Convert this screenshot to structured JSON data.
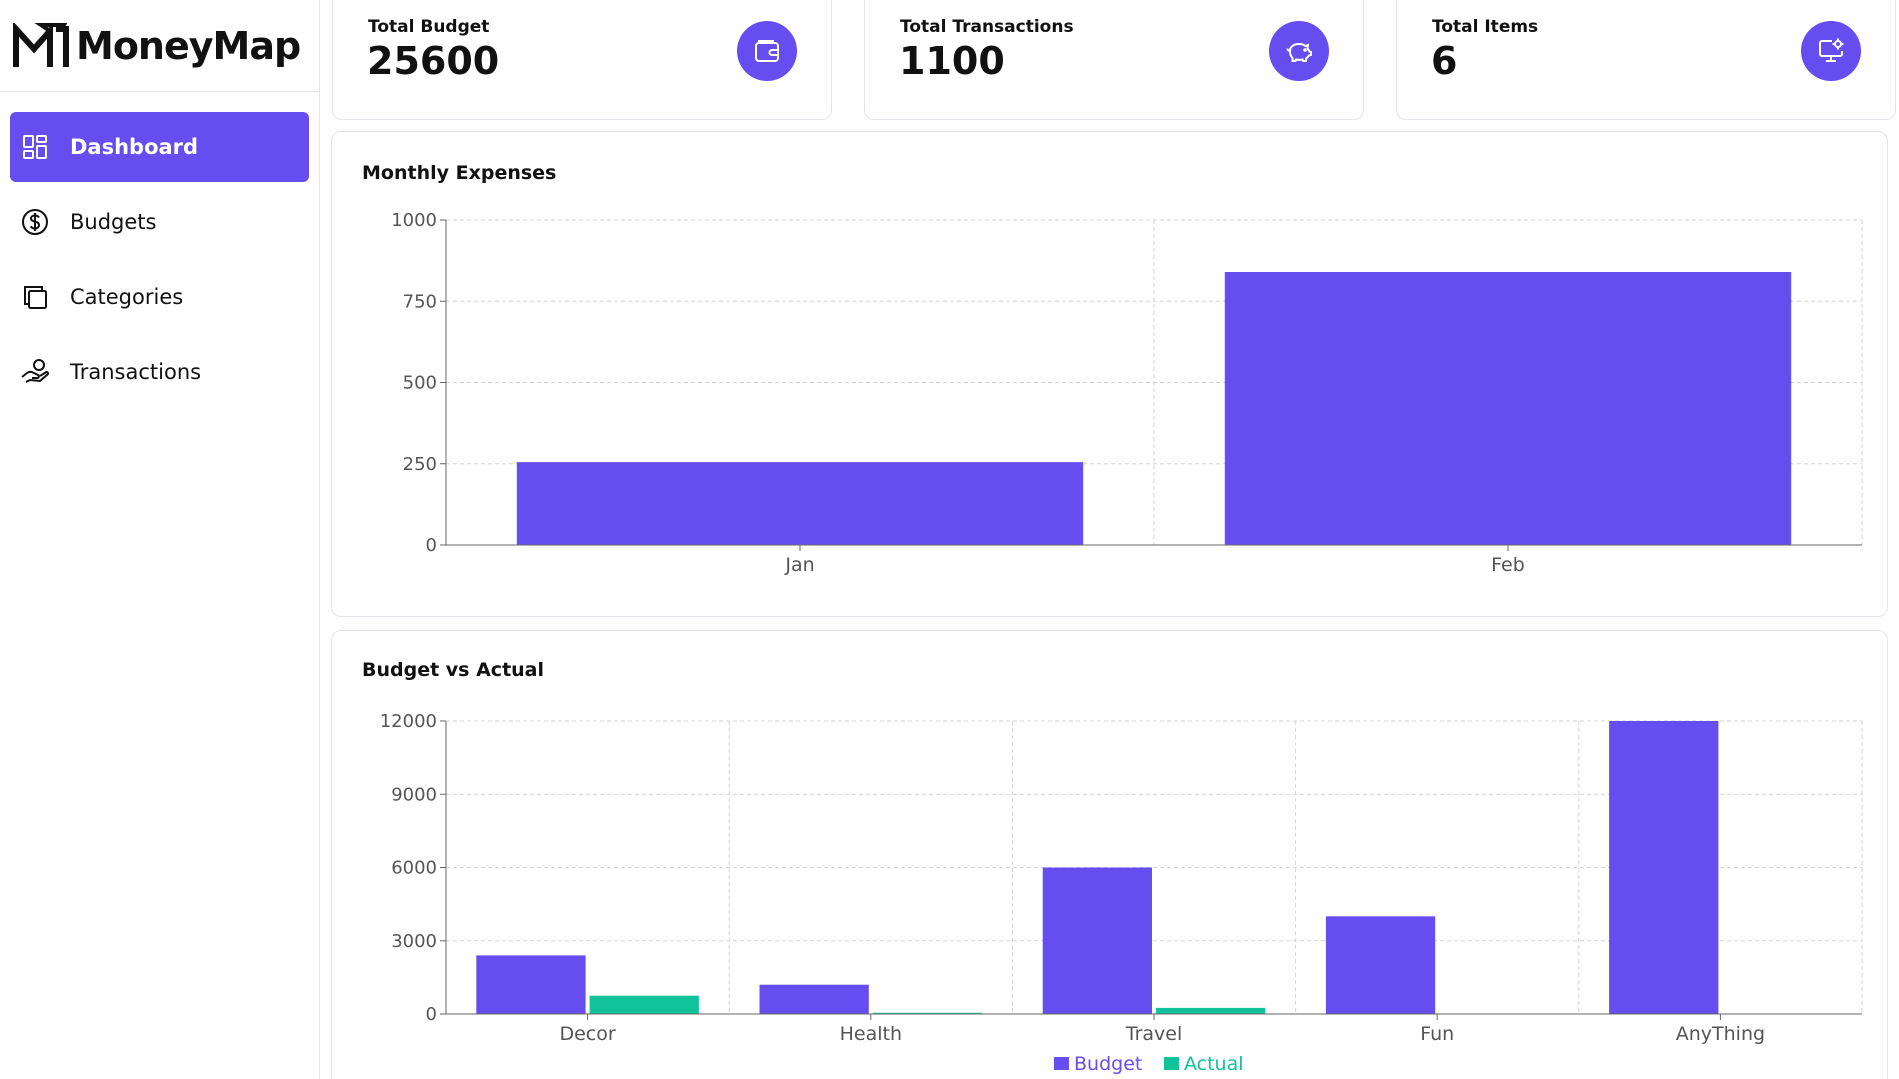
{
  "brand": {
    "name": "MoneyMap"
  },
  "sidebar": {
    "items": [
      {
        "label": "Dashboard",
        "icon": "dashboard-grid-icon",
        "active": true
      },
      {
        "label": "Budgets",
        "icon": "dollar-circle-icon",
        "active": false
      },
      {
        "label": "Categories",
        "icon": "copy-stack-icon",
        "active": false
      },
      {
        "label": "Transactions",
        "icon": "hand-coin-icon",
        "active": false
      }
    ]
  },
  "stats": [
    {
      "title": "Total Budget",
      "value": "25600",
      "icon": "wallet-icon"
    },
    {
      "title": "Total Transactions",
      "value": "1100",
      "icon": "piggy-bank-icon"
    },
    {
      "title": "Total Items",
      "value": "6",
      "icon": "monitor-settings-icon"
    }
  ],
  "colors": {
    "accent": "#654df0",
    "actual": "#11c39a"
  },
  "chart_data": [
    {
      "type": "bar",
      "title": "Monthly Expenses",
      "categories": [
        "Jan",
        "Feb"
      ],
      "series": [
        {
          "values": [
            255,
            840
          ]
        }
      ],
      "ylim": [
        0,
        1000
      ],
      "yticks": [
        0,
        250,
        500,
        750,
        1000
      ],
      "grid": true
    },
    {
      "type": "bar",
      "title": "Budget vs Actual",
      "categories": [
        "Decor",
        "Health",
        "Travel",
        "Fun",
        "AnyThing"
      ],
      "series": [
        {
          "name": "Budget",
          "values": [
            2400,
            1200,
            6000,
            4000,
            12000
          ]
        },
        {
          "name": "Actual",
          "values": [
            750,
            50,
            250,
            0,
            0
          ]
        }
      ],
      "ylim": [
        0,
        12000
      ],
      "yticks": [
        0,
        3000,
        6000,
        9000,
        12000
      ],
      "grid": true,
      "legend": "bottom-center"
    }
  ]
}
